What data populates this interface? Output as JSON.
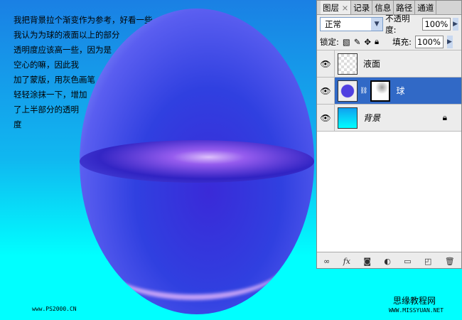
{
  "note_lines": [
    "我把背景拉个渐变作为参考，好看一些",
    "我认为为球的液面以上的部分",
    "透明度应该高一些，因为是",
    "空心的嘛，因此我",
    "加了蒙版，用灰色画笔",
    "轻轻涂抹一下，增加",
    "了上半部分的透明",
    "度"
  ],
  "watermarks": {
    "left": "www.PS2000.CN",
    "right_title": "思缘教程网",
    "right_url": "WWW.MISSYUAN.NET"
  },
  "panel": {
    "tabs": [
      "图层",
      "记录",
      "信息",
      "路径",
      "通道"
    ],
    "tab_close": "×",
    "blend_mode": "正常",
    "opacity_label": "不透明度:",
    "opacity": "100%",
    "lock_label": "锁定:",
    "fill_label": "填充:",
    "fill": "100%",
    "layers": [
      {
        "name": "液面",
        "selected": false
      },
      {
        "name": "球",
        "selected": true
      },
      {
        "name": "背景",
        "selected": false,
        "locked": true
      }
    ],
    "footer_icons": [
      "link-icon",
      "fx-icon",
      "mask-icon",
      "adjustment-icon",
      "folder-icon",
      "new-layer-icon",
      "trash-icon"
    ]
  }
}
